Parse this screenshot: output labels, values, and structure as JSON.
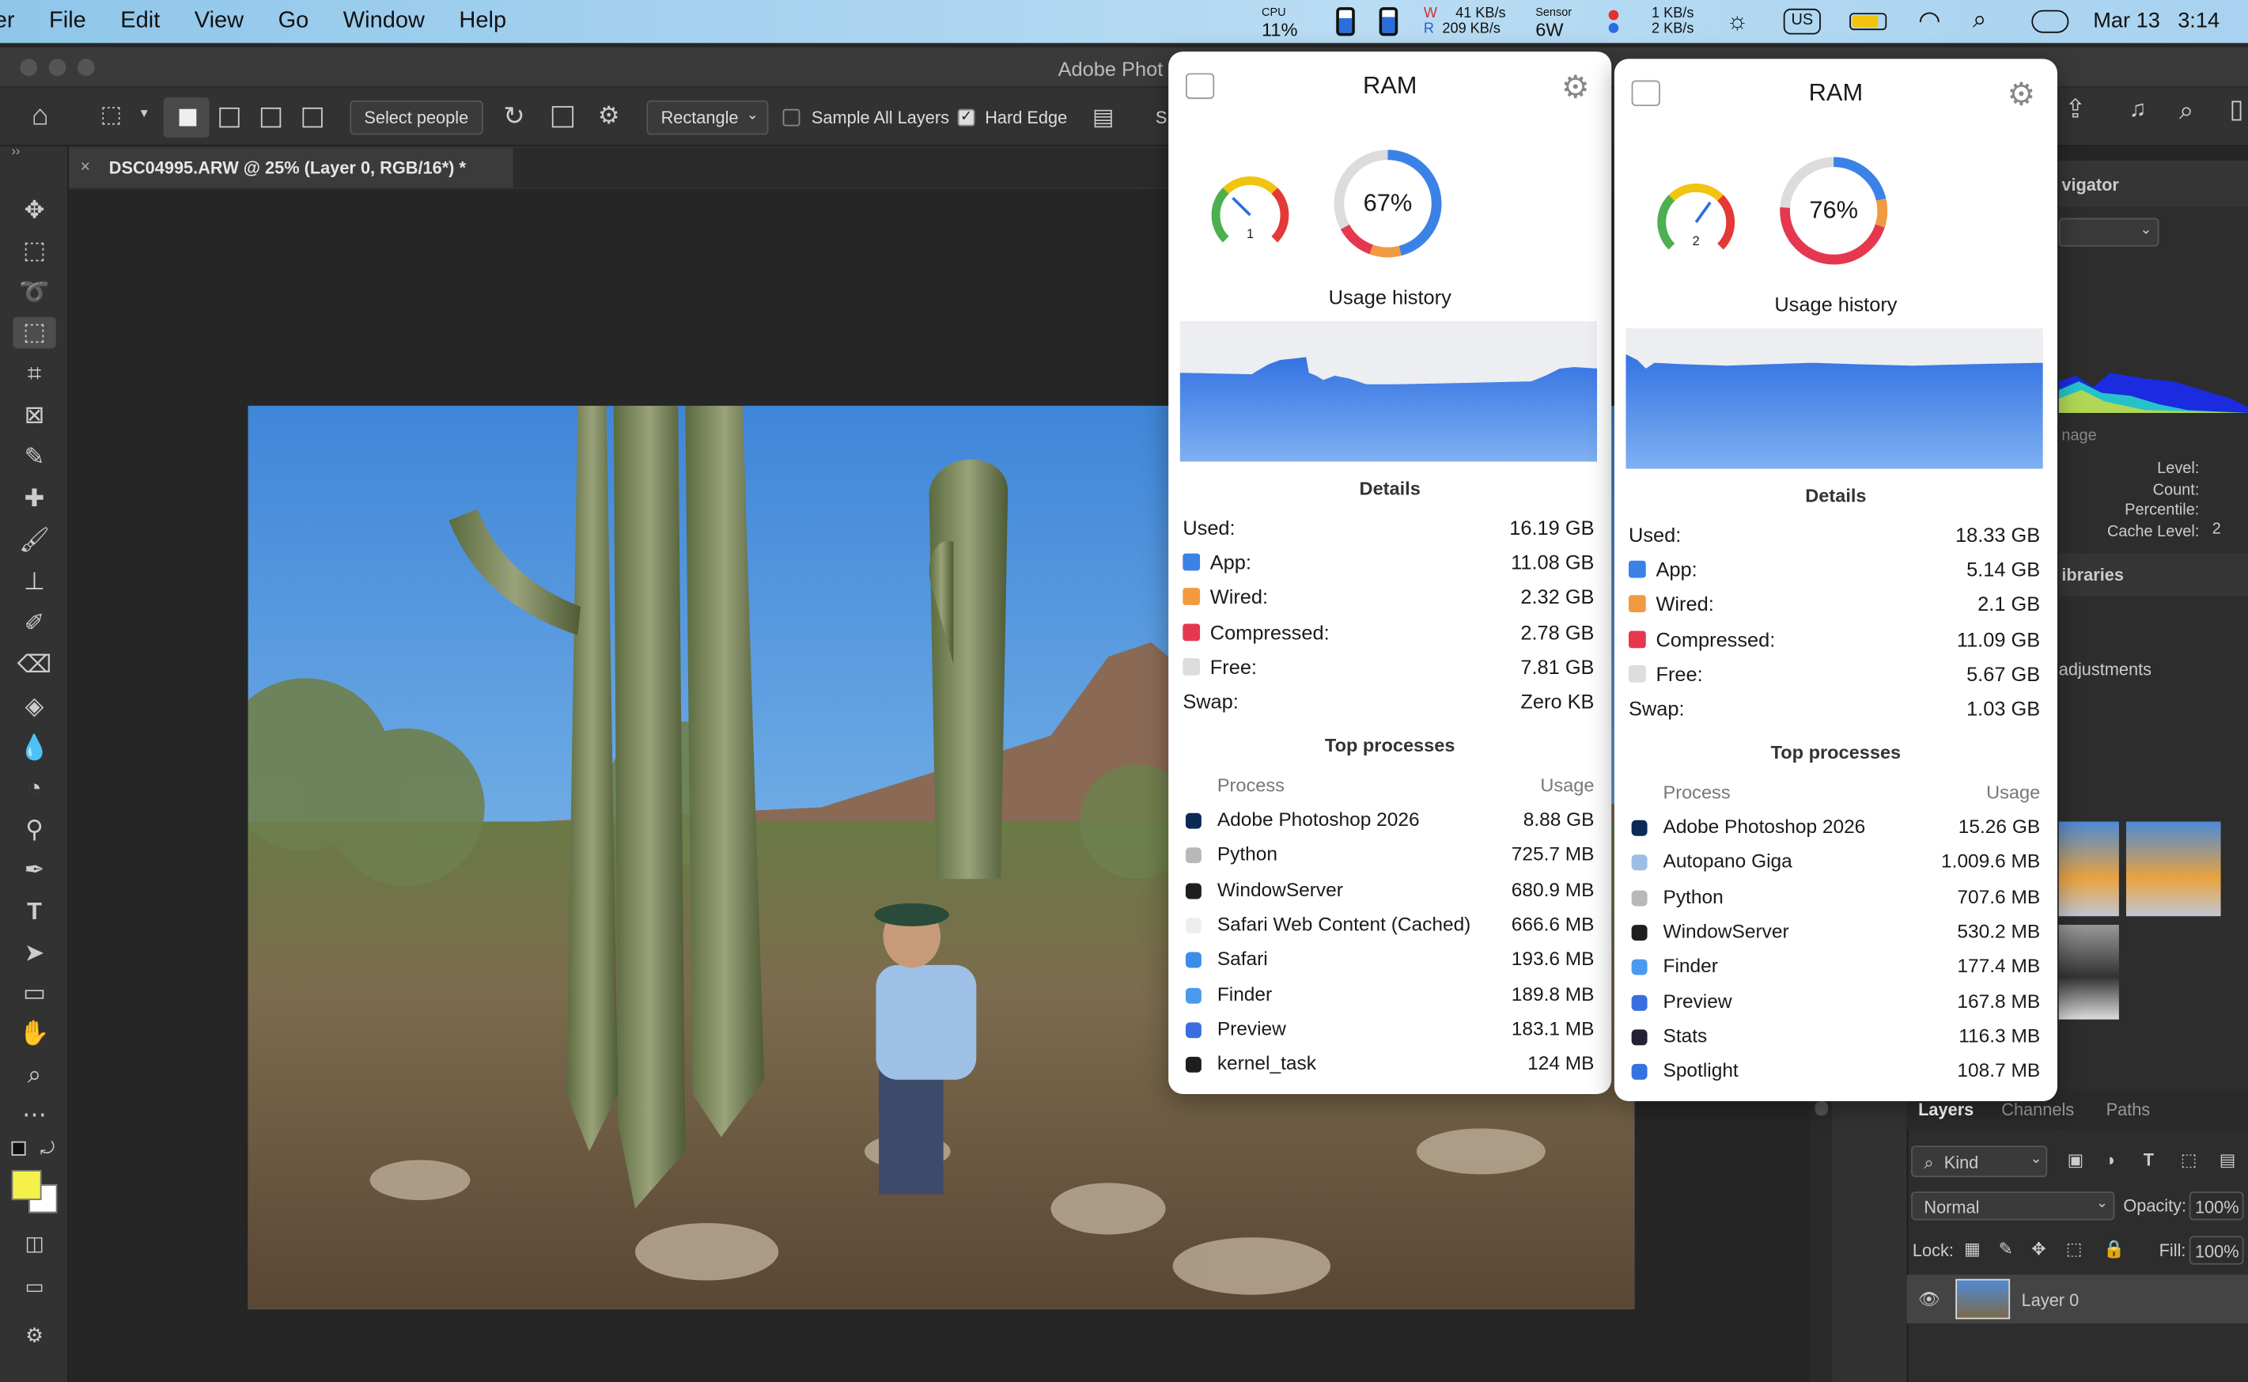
{
  "menubar": {
    "app_fragment": "er",
    "items": [
      "File",
      "Edit",
      "View",
      "Go",
      "Window",
      "Help"
    ],
    "cpu_label": "CPU",
    "cpu_value": "11%",
    "net_w_label": "W",
    "net_r_label": "R",
    "net_up": "41 KB/s",
    "net_down": "209 KB/s",
    "sensor_label": "Sensor",
    "sensor_value": "6W",
    "net2_up": "1 KB/s",
    "net2_down": "2 KB/s",
    "input_source": "US",
    "date": "Mar 13",
    "time": "3:14"
  },
  "photoshop": {
    "window_title": "Adobe Phot",
    "options": {
      "select_people": "Select people",
      "mode": "Rectangle",
      "sample_all_layers": "Sample All Layers",
      "hard_edge": "Hard Edge",
      "trailing": "S"
    },
    "document_tab": "DSC04995.ARW @ 25% (Layer 0, RGB/16*) *",
    "panels": {
      "navigator_fragment": "vigator",
      "image_fragment": "nage",
      "histogram_labels": [
        "Level:",
        "Count:",
        "Percentile:",
        "Cache Level:"
      ],
      "cache_level_value": "2",
      "libraries_fragment": "ibraries",
      "adjustments_fragment": "adjustments",
      "layer_tabs": [
        "Layers",
        "Channels",
        "Paths"
      ],
      "kind": "Kind",
      "blend_mode": "Normal",
      "opacity_label": "Opacity:",
      "opacity_value": "100%",
      "lock_label": "Lock:",
      "fill_label": "Fill:",
      "fill_value": "100%",
      "layer_name": "Layer 0"
    },
    "colors": {
      "foreground": "#f5f04a",
      "background": "#ffffff"
    }
  },
  "ram_popovers": [
    {
      "title": "RAM",
      "pressure": "1",
      "usage_percent": 67,
      "usage_label": "67%",
      "usage_history_label": "Usage history",
      "details_label": "Details",
      "details": [
        {
          "label": "Used:",
          "value": "16.19 GB",
          "color": ""
        },
        {
          "label": "App:",
          "value": "11.08 GB",
          "color": "#3b82e6"
        },
        {
          "label": "Wired:",
          "value": "2.32 GB",
          "color": "#f29a3f"
        },
        {
          "label": "Compressed:",
          "value": "2.78 GB",
          "color": "#e5384f"
        },
        {
          "label": "Free:",
          "value": "7.81 GB",
          "color": "#dddddd"
        },
        {
          "label": "Swap:",
          "value": "Zero KB",
          "color": ""
        }
      ],
      "top_processes_label": "Top processes",
      "process_header": "Process",
      "usage_header": "Usage",
      "processes": [
        {
          "name": "Adobe Photoshop 2026",
          "usage": "8.88 GB",
          "icon": "photoshop-icon"
        },
        {
          "name": "Python",
          "usage": "725.7 MB",
          "icon": "python-icon"
        },
        {
          "name": "WindowServer",
          "usage": "680.9 MB",
          "icon": "windowserver-icon"
        },
        {
          "name": "Safari Web Content (Cached)",
          "usage": "666.6 MB",
          "icon": "document-icon"
        },
        {
          "name": "Safari",
          "usage": "193.6 MB",
          "icon": "safari-icon"
        },
        {
          "name": "Finder",
          "usage": "189.8 MB",
          "icon": "finder-icon"
        },
        {
          "name": "Preview",
          "usage": "183.1 MB",
          "icon": "preview-icon"
        },
        {
          "name": "kernel_task",
          "usage": "124 MB",
          "icon": "kernel-icon"
        }
      ]
    },
    {
      "title": "RAM",
      "pressure": "2",
      "usage_percent": 76,
      "usage_label": "76%",
      "usage_history_label": "Usage history",
      "details_label": "Details",
      "details": [
        {
          "label": "Used:",
          "value": "18.33 GB",
          "color": ""
        },
        {
          "label": "App:",
          "value": "5.14 GB",
          "color": "#3b82e6"
        },
        {
          "label": "Wired:",
          "value": "2.1 GB",
          "color": "#f29a3f"
        },
        {
          "label": "Compressed:",
          "value": "11.09 GB",
          "color": "#e5384f"
        },
        {
          "label": "Free:",
          "value": "5.67 GB",
          "color": "#dddddd"
        },
        {
          "label": "Swap:",
          "value": "1.03 GB",
          "color": ""
        }
      ],
      "top_processes_label": "Top processes",
      "process_header": "Process",
      "usage_header": "Usage",
      "processes": [
        {
          "name": "Adobe Photoshop 2026",
          "usage": "15.26 GB",
          "icon": "photoshop-icon"
        },
        {
          "name": "Autopano Giga",
          "usage": "1.009.6 MB",
          "icon": "autopano-icon"
        },
        {
          "name": "Python",
          "usage": "707.6 MB",
          "icon": "python-icon"
        },
        {
          "name": "WindowServer",
          "usage": "530.2 MB",
          "icon": "windowserver-icon"
        },
        {
          "name": "Finder",
          "usage": "177.4 MB",
          "icon": "finder-icon"
        },
        {
          "name": "Preview",
          "usage": "167.8 MB",
          "icon": "preview-icon"
        },
        {
          "name": "Stats",
          "usage": "116.3 MB",
          "icon": "stats-icon"
        },
        {
          "name": "Spotlight",
          "usage": "108.7 MB",
          "icon": "spotlight-icon"
        }
      ]
    }
  ]
}
